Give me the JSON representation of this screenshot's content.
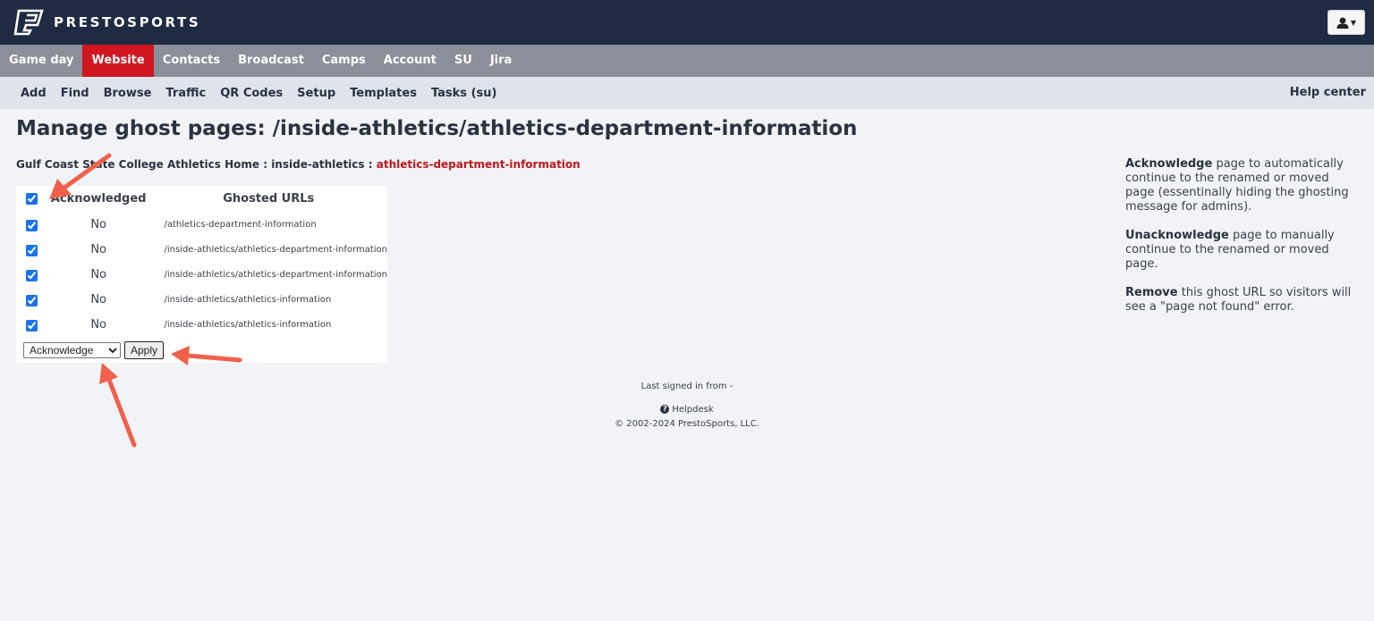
{
  "brand": {
    "name": "PRESTOSPORTS"
  },
  "main_nav": [
    {
      "label": "Game day",
      "active": false
    },
    {
      "label": "Website",
      "active": true
    },
    {
      "label": "Contacts",
      "active": false
    },
    {
      "label": "Broadcast",
      "active": false
    },
    {
      "label": "Camps",
      "active": false
    },
    {
      "label": "Account",
      "active": false
    },
    {
      "label": "SU",
      "active": false
    },
    {
      "label": "Jira",
      "active": false
    }
  ],
  "sub_nav": [
    "Add",
    "Find",
    "Browse",
    "Traffic",
    "QR Codes",
    "Setup",
    "Templates",
    "Tasks (su)"
  ],
  "help_center": "Help center",
  "page_title": "Manage ghost pages: /inside-athletics/athletics-department-information",
  "breadcrumb": {
    "home": "Gulf Coast State College Athletics Home",
    "sep": ":",
    "section": "inside-athletics",
    "current": "athletics-department-information"
  },
  "table": {
    "headers": {
      "acknowledged": "Acknowledged",
      "urls": "Ghosted URLs"
    },
    "select_all_checked": true,
    "rows": [
      {
        "checked": true,
        "acknowledged": "No",
        "url": "/athletics-department-information"
      },
      {
        "checked": true,
        "acknowledged": "No",
        "url": "/inside-athletics/athletics-department-information"
      },
      {
        "checked": true,
        "acknowledged": "No",
        "url": "/inside-athletics/athletics-department-information"
      },
      {
        "checked": true,
        "acknowledged": "No",
        "url": "/inside-athletics/athletics-information"
      },
      {
        "checked": true,
        "acknowledged": "No",
        "url": "/inside-athletics/athletics-information"
      }
    ]
  },
  "actions": {
    "selected": "Acknowledge",
    "options": [
      "Acknowledge"
    ],
    "apply_label": "Apply"
  },
  "info": [
    {
      "term": "Acknowledge",
      "text": " page to automatically continue to the renamed or moved page (essentinally hiding the ghosting message for admins)."
    },
    {
      "term": "Unacknowledge",
      "text": " page to manually continue to the renamed or moved page."
    },
    {
      "term": "Remove",
      "text": " this ghost URL so visitors will see a \"page not found\" error."
    }
  ],
  "footer": {
    "last_signed": "Last signed in from -",
    "helpdesk": "Helpdesk",
    "copyright": "© 2002-2024 PrestoSports, LLC."
  },
  "colors": {
    "topbar": "#1e2b42",
    "main_nav": "#8a8f99",
    "active_tab": "#d0171f",
    "sub_nav": "#dfe3ea",
    "page_bg": "#f1f3f7",
    "breadcrumb_current": "#c0161c",
    "annotation_arrow": "#f0604a"
  }
}
